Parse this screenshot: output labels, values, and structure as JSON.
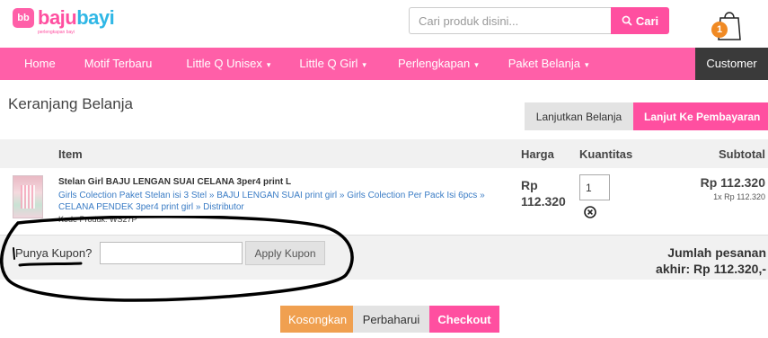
{
  "brand": {
    "badge": "bb",
    "name_part1": "baju",
    "name_part2": "bayi",
    "tagline": "perlengkapan bayi"
  },
  "search": {
    "placeholder": "Cari produk disini...",
    "button_label": "Cari"
  },
  "cart": {
    "count": "1"
  },
  "nav": {
    "items": [
      {
        "label": "Home"
      },
      {
        "label": "Motif Terbaru"
      },
      {
        "label": "Little Q Unisex",
        "caret": "▾"
      },
      {
        "label": "Little Q Girl",
        "caret": "▾"
      },
      {
        "label": "Perlengkapan",
        "caret": "▾"
      },
      {
        "label": "Paket Belanja",
        "caret": "▾"
      }
    ],
    "customer": "Customer"
  },
  "page": {
    "title": "Keranjang Belanja",
    "continue_label": "Lanjutkan Belanja",
    "proceed_label": "Lanjut Ke Pembayaran"
  },
  "table": {
    "headers": {
      "item": "Item",
      "price": "Harga",
      "qty": "Kuantitas",
      "subtotal": "Subtotal"
    },
    "rows": [
      {
        "name": "Stelan Girl BAJU LENGAN SUAI CELANA 3per4 print L",
        "categories": "Girls Colection Paket Stelan isi 3 Stel » BAJU LENGAN SUAI print girl » Girls Colection Per Pack Isi 6pcs » CELANA PENDEK 3per4 print girl » Distributor",
        "code": "Kode Produk: WS27P",
        "price_currency": "Rp",
        "price_amount": "112.320",
        "quantity": "1",
        "subtotal": "Rp 112.320",
        "subtotal_detail": "1x Rp 112.320"
      }
    ]
  },
  "coupon": {
    "label": "Punya Kupon?",
    "value": "",
    "button_label": "Apply Kupon"
  },
  "total": {
    "line1": "Jumlah pesanan",
    "line2": "akhir: Rp 112.320,-"
  },
  "actions": {
    "empty_label": "Kosongkan",
    "update_label": "Perbaharui",
    "checkout_label": "Checkout"
  },
  "colors": {
    "primary": "#ff5fa8",
    "accent": "#f0a050",
    "dark": "#3a3a3a",
    "link": "#3a7cc5"
  }
}
